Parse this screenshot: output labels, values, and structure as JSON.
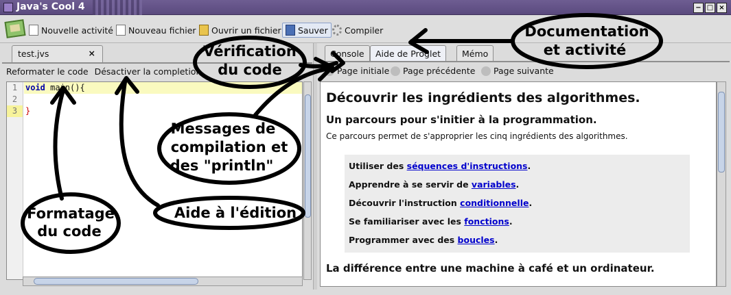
{
  "window": {
    "title": "Java's Cool 4",
    "buttons": [
      "−",
      "□",
      "×"
    ]
  },
  "toolbar": {
    "new_activity": "Nouvelle activité",
    "new_file": "Nouveau fichier",
    "open_file": "Ouvrir un fichier",
    "save": "Sauver",
    "compile": "Compiler"
  },
  "editor": {
    "tab": "test.jvs",
    "close": "×",
    "reformat": "Reformater le code",
    "completion": "Désactiver la completion",
    "lines": [
      "1",
      "2",
      "3"
    ]
  },
  "right": {
    "tabs": [
      "Console",
      "Aide de Proglet",
      "Mémo"
    ],
    "nav": [
      "Page initiale",
      "Page précédente",
      "Page suivante"
    ]
  },
  "doc": {
    "h1": "Découvrir les ingrédients des algorithmes.",
    "h2": "Un parcours pour s'initier à la programmation.",
    "intro": "Ce parcours permet de s'approprier les cinq ingrédients des algorithmes.",
    "items": [
      {
        "pre": "Utiliser des ",
        "link": "séquences d'instructions",
        "post": "."
      },
      {
        "pre": "Apprendre à se servir de ",
        "link": "variables",
        "post": "."
      },
      {
        "pre": "Découvrir l'instruction ",
        "link": "conditionnelle",
        "post": "."
      },
      {
        "pre": "Se familiariser avec les ",
        "link": "fonctions",
        "post": "."
      },
      {
        "pre": "Programmer avec des ",
        "link": "boucles",
        "post": "."
      }
    ],
    "h2b": "La différence entre une machine à café et un ordinateur."
  },
  "annotations": {
    "verif_1": "Vérification",
    "verif_2": "du code",
    "docu_1": "Documentation",
    "docu_2": "et activité",
    "msg_1": "Messages de",
    "msg_2": "compilation et",
    "msg_3": "des \"println\"",
    "fmt_1": "Formatage",
    "fmt_2": "du code",
    "aide": "Aide à l'édition"
  }
}
